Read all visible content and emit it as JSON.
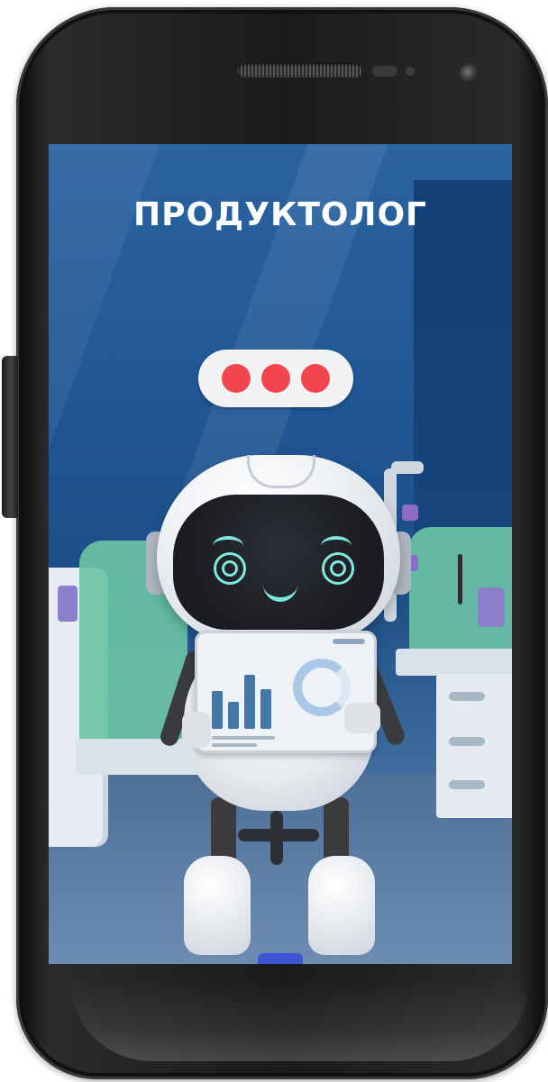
{
  "screen": {
    "title": "ПРОДУКТОЛОГ",
    "typing_indicator": {
      "dot_count": 3,
      "dot_color": "#f2454f"
    }
  },
  "theme": {
    "background": "#1f5592",
    "accent": "#7fe8dd",
    "device_body": "#1b1b1b"
  },
  "icons": {
    "camera": "camera-icon",
    "speaker": "speaker-grille-icon"
  }
}
